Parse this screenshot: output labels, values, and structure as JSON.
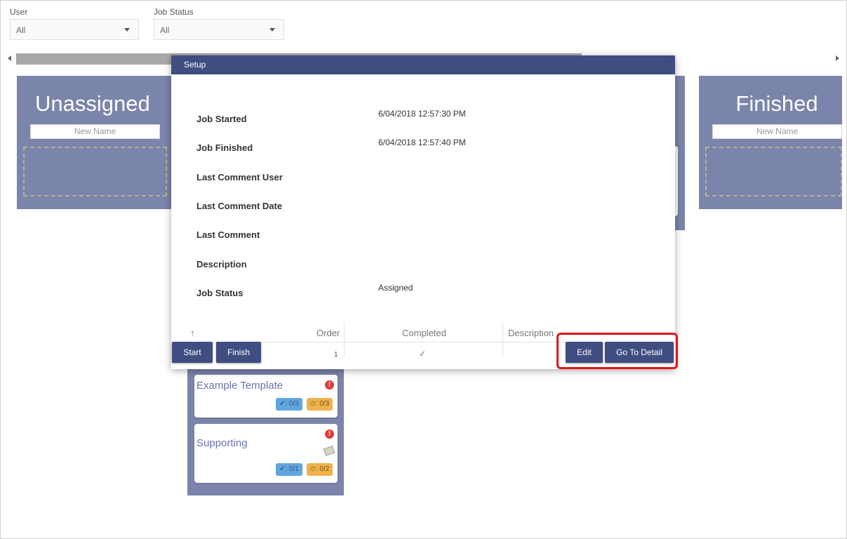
{
  "filters": {
    "user": {
      "label": "User",
      "value": "All"
    },
    "job_status": {
      "label": "Job Status",
      "value": "All"
    }
  },
  "columns": [
    {
      "title": "Unassigned",
      "new_name_placeholder": "New Name"
    },
    {
      "title": "Finished",
      "new_name_placeholder": "New Name"
    }
  ],
  "cards": [
    {
      "title": "Example Template",
      "alert": "!",
      "checks": "✔: 0/3",
      "time": "⏲: 0/3"
    },
    {
      "title": "Supporting",
      "alert": "!",
      "checks": "✔: 0/1",
      "time": "⏲: 0/2"
    }
  ],
  "modal": {
    "title": "Setup",
    "fields": [
      {
        "label": "Job Started",
        "value": "6/04/2018 12:57:30 PM"
      },
      {
        "label": "Job Finished",
        "value": "6/04/2018 12:57:40 PM"
      },
      {
        "label": "Last Comment User",
        "value": ""
      },
      {
        "label": "Last Comment Date",
        "value": ""
      },
      {
        "label": "Last Comment",
        "value": ""
      },
      {
        "label": "Description",
        "value": ""
      },
      {
        "label": "Job Status",
        "value": "Assigned"
      }
    ],
    "table": {
      "sort_icon": "↑",
      "headers": {
        "order": "Order",
        "completed": "Completed",
        "description": "Description"
      },
      "row": {
        "order": "1",
        "completed": "✓"
      }
    },
    "buttons": {
      "start": "Start",
      "finish": "Finish",
      "edit": "Edit",
      "go_to_detail": "Go To Detail"
    }
  },
  "colors": {
    "header": "#3f4d80",
    "column": "#7b84aa",
    "highlight": "#e0161b"
  }
}
